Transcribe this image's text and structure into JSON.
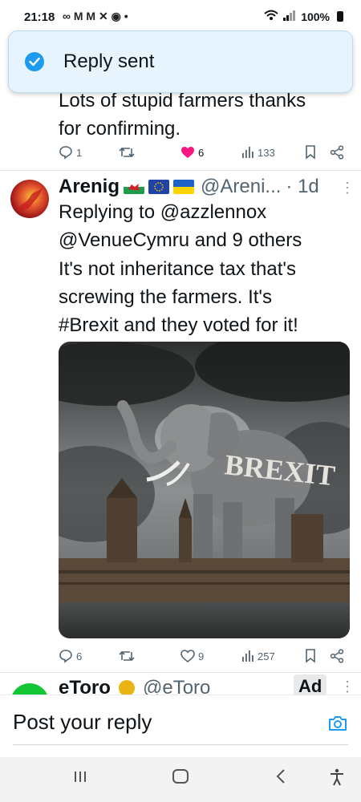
{
  "status_bar": {
    "time": "21:18",
    "left_icons": "∞ M M ✕ ◉ •",
    "battery": "100%"
  },
  "toast": {
    "text": "Reply sent",
    "icon": "check-circle-icon"
  },
  "previous_tweet": {
    "text_line1": "Lots of stupid farmers thanks",
    "text_line2": "for confirming.",
    "actions": {
      "replies": "1",
      "retweets": "",
      "likes": "6",
      "views": "133"
    }
  },
  "tweet": {
    "name": "Arenig",
    "handle": "@Areni...",
    "time": "· 1d",
    "flags": [
      "wales-flag",
      "eu-flag",
      "ukraine-flag"
    ],
    "reply_to_line1": "Replying to @azzlennox",
    "reply_to_line2": "@VenueCymru and 9 others",
    "text_line1": "It's not inheritance tax that's",
    "text_line2": "screwing the farmers. It's",
    "text_line3": "#Brexit and they voted for it!",
    "image_text": "BREXIT",
    "actions": {
      "replies": "6",
      "retweets": "",
      "likes": "9",
      "views": "257"
    }
  },
  "ad_tweet": {
    "name": "eToro",
    "handle": "@eToro",
    "badge": "Ad"
  },
  "composer": {
    "placeholder": "Post your reply"
  },
  "colors": {
    "accent": "#1d9bf0",
    "like": "#f91880",
    "text": "#0f1419",
    "muted": "#536471"
  }
}
